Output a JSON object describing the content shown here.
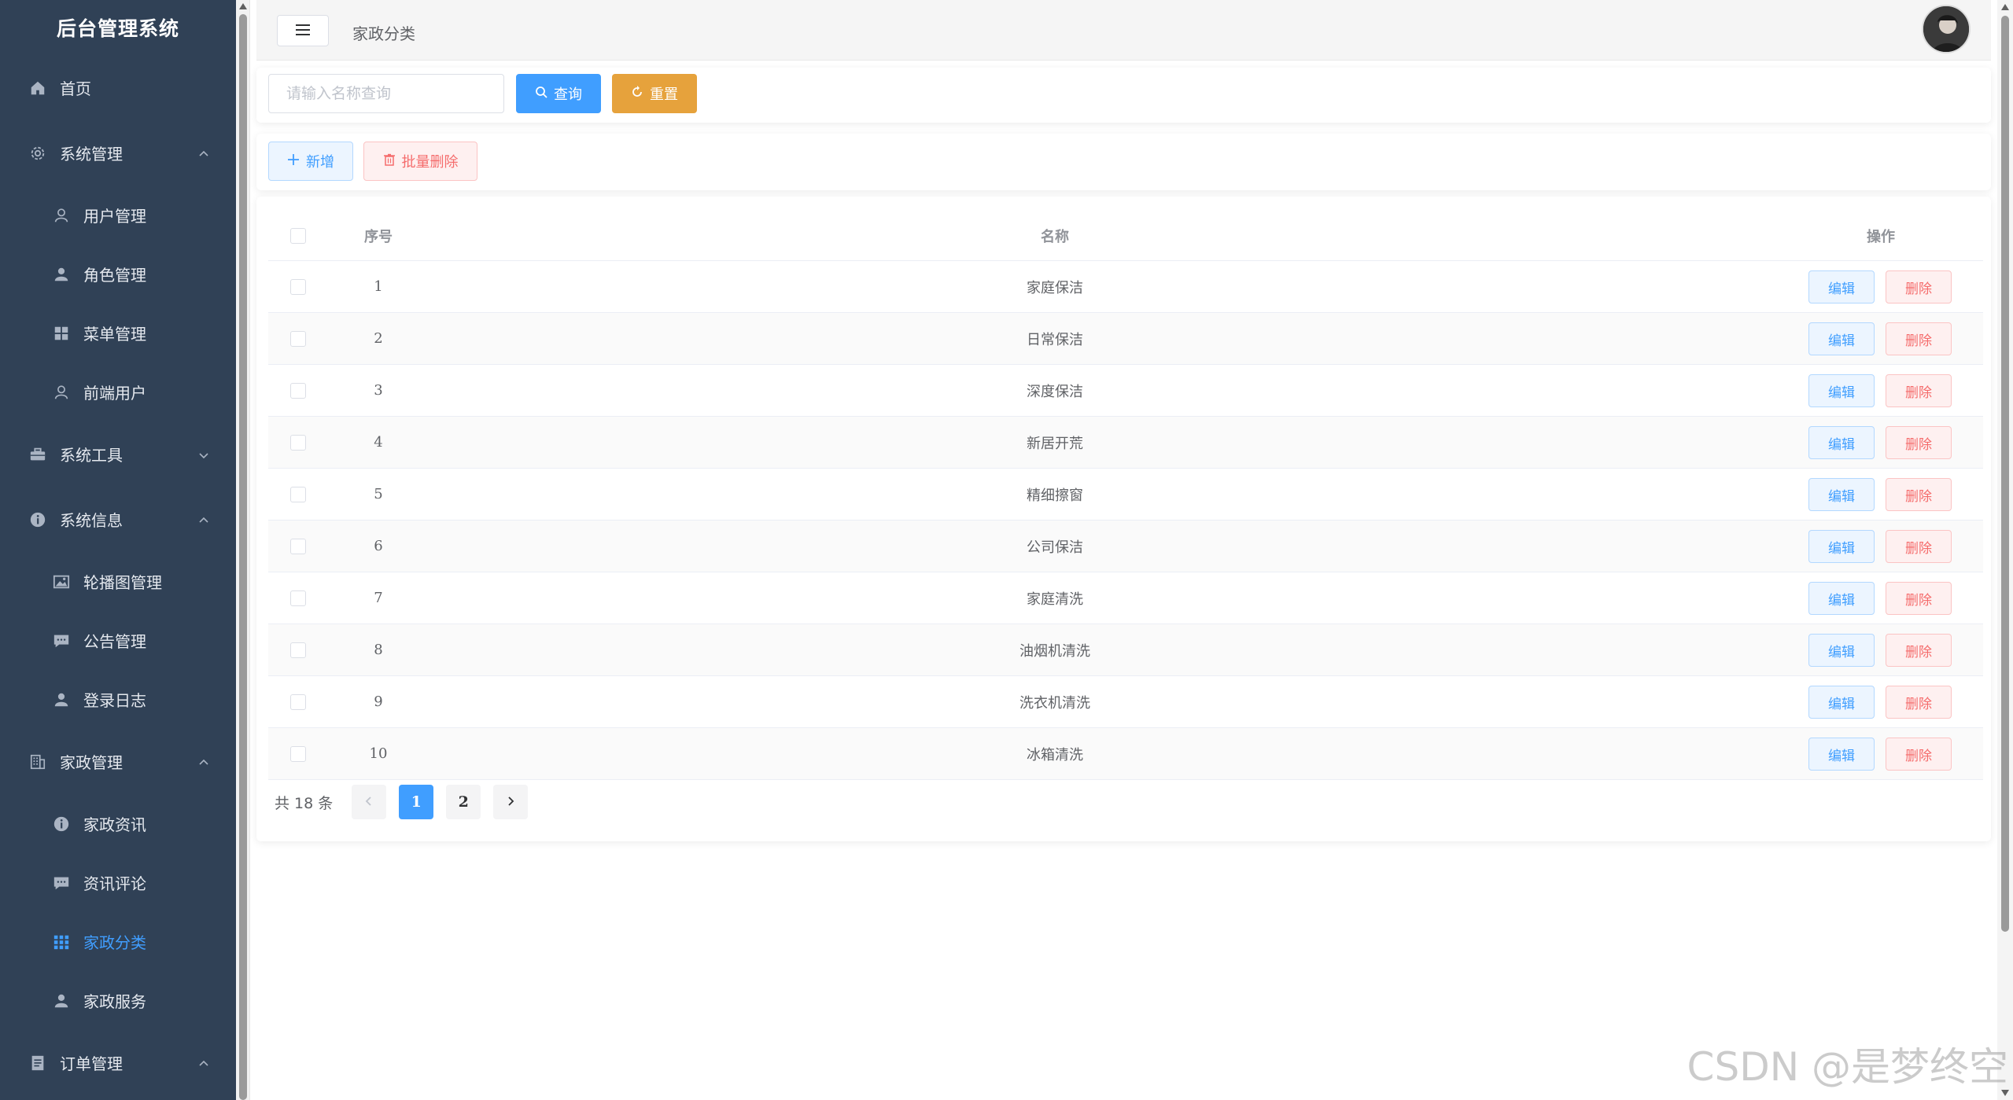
{
  "sidebar": {
    "title": "后台管理系统",
    "items": [
      {
        "label": "首页",
        "icon": "home-icon",
        "level": "top"
      },
      {
        "label": "系统管理",
        "icon": "gear-icon",
        "level": "top",
        "arrow": "up"
      },
      {
        "label": "用户管理",
        "icon": "user-outline-icon",
        "level": "sub"
      },
      {
        "label": "角色管理",
        "icon": "user-filled-icon",
        "level": "sub"
      },
      {
        "label": "菜单管理",
        "icon": "grid-icon",
        "level": "sub"
      },
      {
        "label": "前端用户",
        "icon": "user-outline-icon",
        "level": "sub"
      },
      {
        "label": "系统工具",
        "icon": "toolbox-icon",
        "level": "top",
        "arrow": "down"
      },
      {
        "label": "系统信息",
        "icon": "info-icon",
        "level": "top",
        "arrow": "up"
      },
      {
        "label": "轮播图管理",
        "icon": "picture-icon",
        "level": "sub"
      },
      {
        "label": "公告管理",
        "icon": "chat-icon",
        "level": "sub"
      },
      {
        "label": "登录日志",
        "icon": "user-filled-icon",
        "level": "sub"
      },
      {
        "label": "家政管理",
        "icon": "building-icon",
        "level": "top",
        "arrow": "up"
      },
      {
        "label": "家政资讯",
        "icon": "info-icon",
        "level": "sub"
      },
      {
        "label": "资讯评论",
        "icon": "chat-icon",
        "level": "sub"
      },
      {
        "label": "家政分类",
        "icon": "menu-grid-icon",
        "level": "sub",
        "active": true
      },
      {
        "label": "家政服务",
        "icon": "user-filled-icon",
        "level": "sub"
      },
      {
        "label": "订单管理",
        "icon": "document-icon",
        "level": "top",
        "arrow": "up"
      }
    ]
  },
  "header": {
    "breadcrumb": "家政分类",
    "hamburger": "≡"
  },
  "search": {
    "placeholder": "请输入名称查询",
    "query_label": "查询",
    "reset_label": "重置"
  },
  "toolbar": {
    "add_label": "新增",
    "bulk_delete_label": "批量删除"
  },
  "table": {
    "columns": {
      "index": "序号",
      "name": "名称",
      "ops": "操作"
    },
    "edit_label": "编辑",
    "delete_label": "删除",
    "rows": [
      {
        "index": "1",
        "name": "家庭保洁"
      },
      {
        "index": "2",
        "name": "日常保洁"
      },
      {
        "index": "3",
        "name": "深度保洁"
      },
      {
        "index": "4",
        "name": "新居开荒"
      },
      {
        "index": "5",
        "name": "精细擦窗"
      },
      {
        "index": "6",
        "name": "公司保洁"
      },
      {
        "index": "7",
        "name": "家庭清洗"
      },
      {
        "index": "8",
        "name": "油烟机清洗"
      },
      {
        "index": "9",
        "name": "洗衣机清洗"
      },
      {
        "index": "10",
        "name": "冰箱清洗"
      }
    ]
  },
  "pagination": {
    "total": "共 18 条",
    "pages": [
      "1",
      "2"
    ],
    "current": "1"
  },
  "watermark": "CSDN @是梦终空",
  "colors": {
    "sidebar_bg": "#304156",
    "primary": "#409eff",
    "warning": "#e6a23c",
    "danger": "#f56c6c"
  }
}
